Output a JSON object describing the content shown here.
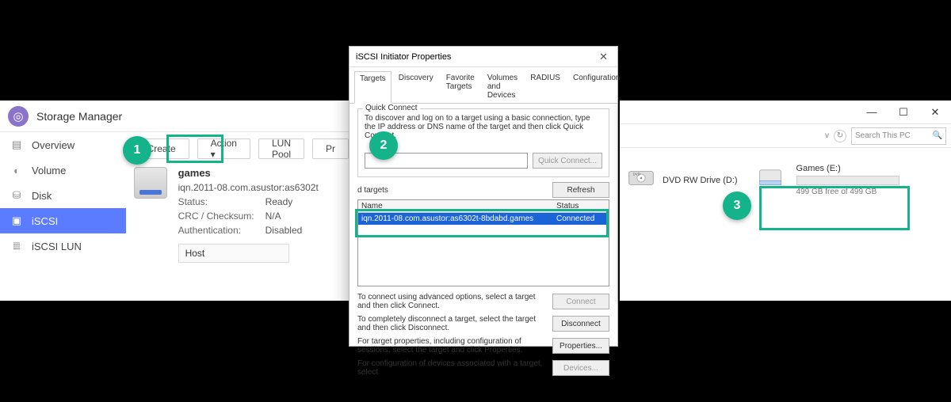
{
  "callouts": {
    "one": "1",
    "two": "2",
    "three": "3"
  },
  "storage_manager": {
    "title": "Storage Manager",
    "nav": {
      "overview": "Overview",
      "volume": "Volume",
      "disk": "Disk",
      "iscsi": "iSCSI",
      "iscsi_lun": "iSCSI LUN"
    },
    "toolbar": {
      "create": "Create",
      "action": "Action ▾",
      "lun_pool": "LUN Pool",
      "preferences_truncated": "Pr"
    },
    "target": {
      "name": "games",
      "iqn": "iqn.2011-08.com.asustor:as6302t",
      "status_k": "Status:",
      "status_v": "Ready",
      "crc_k": "CRC / Checksum:",
      "crc_v": "N/A",
      "auth_k": "Authentication:",
      "auth_v": "Disabled",
      "host_label": "Host"
    }
  },
  "iscsi_dialog": {
    "title": "iSCSI Initiator Properties",
    "tabs": {
      "targets": "Targets",
      "discovery": "Discovery",
      "favorite": "Favorite Targets",
      "volumes": "Volumes and Devices",
      "radius": "RADIUS",
      "config": "Configuration"
    },
    "quick_connect": {
      "group": "Quick Connect",
      "desc": "To discover and log on to a target using a basic connection, type the IP address or DNS name of the target and then click Quick Connect.",
      "btn": "Quick Connect..."
    },
    "discovered": {
      "label": "d targets",
      "refresh": "Refresh",
      "col_name": "Name",
      "col_status": "Status",
      "row_name": "iqn.2011-08.com.asustor:as6302t-8bdabd.games",
      "row_status": "Connected"
    },
    "help": {
      "l1": "To connect using advanced options, select a target and then click Connect.",
      "l2": "To completely disconnect a target, select the target and then click Disconnect.",
      "l3": "For target properties, including configuration of sessions, select the target and click Properties.",
      "l4": "For configuration of devices associated with a target, select"
    },
    "buttons": {
      "connect": "Connect",
      "disconnect": "Disconnect",
      "properties": "Properties...",
      "devices": "Devices..."
    }
  },
  "explorer": {
    "search_placeholder": "Search This PC",
    "dvd": "DVD RW Drive (D:)",
    "games_drive": {
      "label": "Games (E:)",
      "free": "499 GB free of 499 GB"
    }
  }
}
